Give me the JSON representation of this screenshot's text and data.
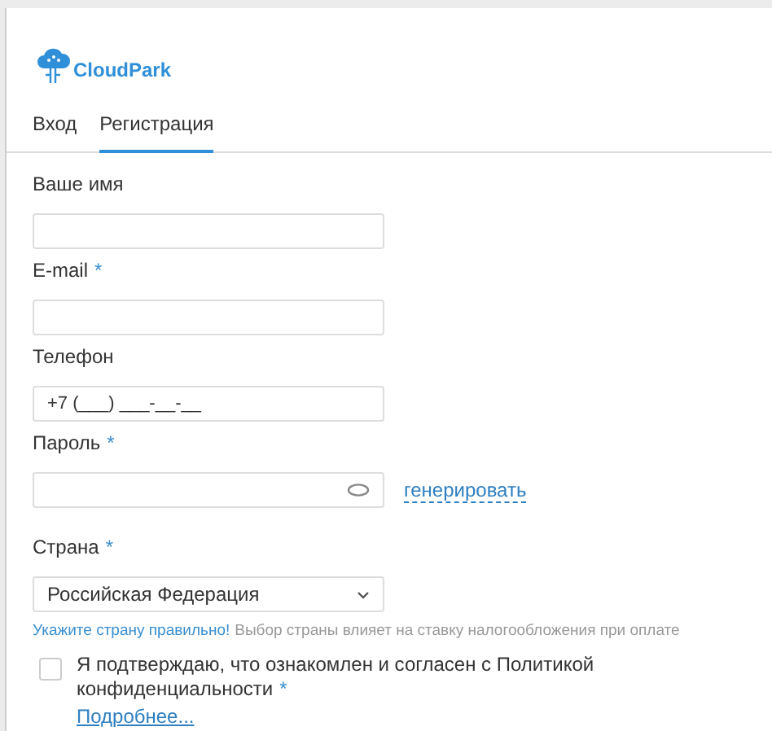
{
  "logo": {
    "text": "CloudPark"
  },
  "tabs": [
    {
      "label": "Вход",
      "selected": false
    },
    {
      "label": "Регистрация",
      "selected": true
    }
  ],
  "fields": [
    {
      "kind": "text",
      "label": "Ваше имя"
    },
    {
      "kind": "text",
      "label": "E-mail",
      "required_mark": "*"
    },
    {
      "kind": "text",
      "label": "Телефон",
      "value": "+7 (___) ___-__-__"
    },
    {
      "kind": "password",
      "label": "Пароль",
      "required_mark": "*",
      "action": "генерировать"
    },
    {
      "kind": "select",
      "label": "Страна",
      "required_mark": "*",
      "value": "Российская Федерация"
    }
  ],
  "hint": {
    "emphasis": "Укажите страну правильно!",
    "text": "Выбор страны влияет на ставку налогообложения при оплате"
  },
  "consent": {
    "checked": false,
    "text": "Я подтверждаю, что ознакомлен и согласен с Политикой конфиденциальности",
    "required_mark": "*",
    "link": "Подробнее..."
  }
}
